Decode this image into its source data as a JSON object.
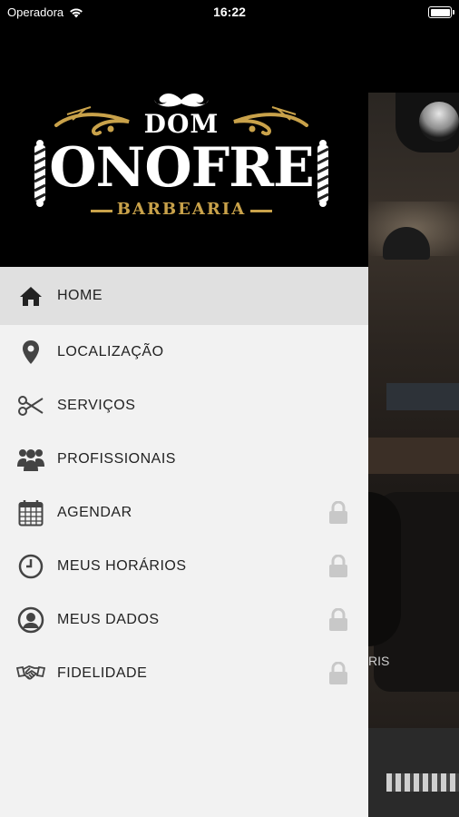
{
  "status_bar": {
    "carrier": "Operadora",
    "time": "16:22"
  },
  "brand": {
    "line1": "DOM",
    "line2": "ONOFRE",
    "line3": "BARBEARIA",
    "gold_color": "#c9a24a"
  },
  "menu": {
    "items": [
      {
        "label": "HOME",
        "icon": "home-icon",
        "active": true,
        "locked": false
      },
      {
        "label": "LOCALIZAÇÃO",
        "icon": "location-pin-icon",
        "active": false,
        "locked": false
      },
      {
        "label": "SERVIÇOS",
        "icon": "scissors-icon",
        "active": false,
        "locked": false
      },
      {
        "label": "PROFISSIONAIS",
        "icon": "people-icon",
        "active": false,
        "locked": false
      },
      {
        "label": "AGENDAR",
        "icon": "calendar-icon",
        "active": false,
        "locked": true
      },
      {
        "label": "MEUS HORÁRIOS",
        "icon": "clock-icon",
        "active": false,
        "locked": true
      },
      {
        "label": "MEUS DADOS",
        "icon": "user-icon",
        "active": false,
        "locked": true
      },
      {
        "label": "FIDELIDADE",
        "icon": "handshake-icon",
        "active": false,
        "locked": true
      }
    ]
  },
  "background_app": {
    "partial_text": "RIS"
  }
}
